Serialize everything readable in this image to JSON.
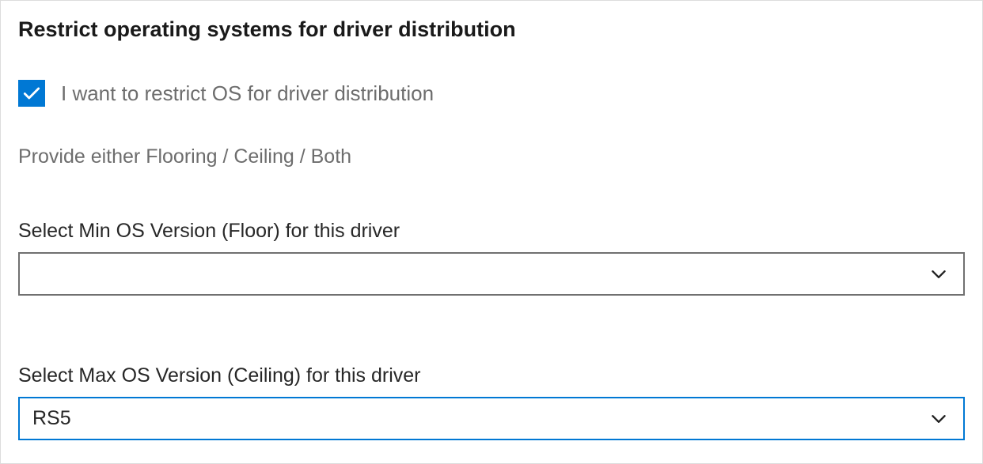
{
  "colors": {
    "accent": "#0078d4"
  },
  "heading": "Restrict operating systems for driver distribution",
  "checkbox": {
    "checked": true,
    "label": "I want to restrict OS for driver distribution"
  },
  "helper": "Provide either Flooring / Ceiling / Both",
  "min": {
    "label": "Select Min OS Version (Floor) for this driver",
    "value": ""
  },
  "max": {
    "label": "Select Max OS Version (Ceiling) for this driver",
    "value": "RS5"
  }
}
